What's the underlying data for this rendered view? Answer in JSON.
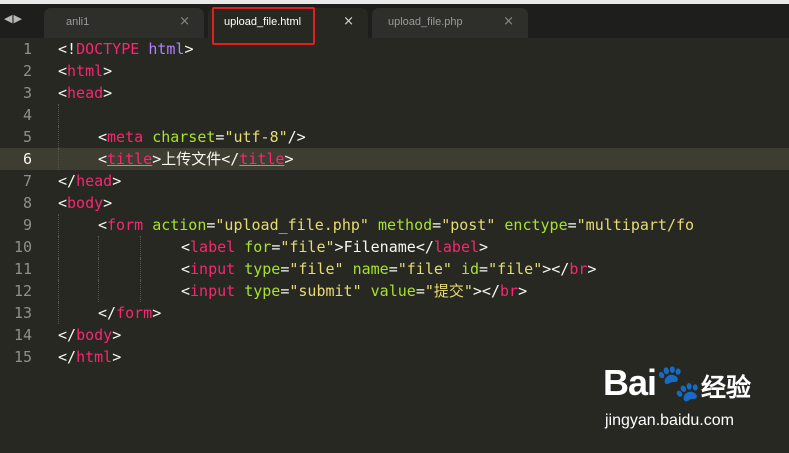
{
  "nav": {
    "arrows": "◀▶"
  },
  "tabs": [
    {
      "label": "anli1",
      "close": "×"
    },
    {
      "label": "upload_file.html",
      "close": "×"
    },
    {
      "label": "upload_file.php",
      "close": "×"
    }
  ],
  "gutter": [
    "1",
    "2",
    "3",
    "4",
    "5",
    "6",
    "7",
    "8",
    "9",
    "10",
    "11",
    "12",
    "13",
    "14",
    "15"
  ],
  "code": {
    "l1": {
      "p1": "<!",
      "tag": "DOCTYPE",
      "sp": " ",
      "name": "html",
      "p2": ">"
    },
    "l2": {
      "p1": "<",
      "tag": "html",
      "p2": ">"
    },
    "l3": {
      "p1": "<",
      "tag": "head",
      "p2": ">"
    },
    "l5": {
      "p1": "<",
      "tag": "meta",
      "sp": " ",
      "a1": "charset",
      "eq": "=",
      "v1": "\"utf-8\"",
      "p2": "/>"
    },
    "l6": {
      "p1": "<",
      "tag": "title",
      "p2": ">",
      "text": "上传文件",
      "p3": "</",
      "ctag": "title",
      "p4": ">"
    },
    "l7": {
      "p1": "</",
      "tag": "head",
      "p2": ">"
    },
    "l8": {
      "p1": "<",
      "tag": "body",
      "p2": ">"
    },
    "l9": {
      "p1": "<",
      "tag": "form",
      "sp1": " ",
      "a1": "action",
      "eq1": "=",
      "v1": "\"upload_file.php\"",
      "sp2": " ",
      "a2": "method",
      "eq2": "=",
      "v2": "\"post\"",
      "sp3": " ",
      "a3": "enctype",
      "eq3": "=",
      "v3": "\"multipart/fo"
    },
    "l10": {
      "p1": "<",
      "tag": "label",
      "sp": " ",
      "a1": "for",
      "eq": "=",
      "v1": "\"file\"",
      "p2": ">",
      "text": "Filename",
      "p3": "</",
      "ctag": "label",
      "p4": ">"
    },
    "l11": {
      "p1": "<",
      "tag": "input",
      "sp1": " ",
      "a1": "type",
      "eq1": "=",
      "v1": "\"file\"",
      "sp2": " ",
      "a2": "name",
      "eq2": "=",
      "v2": "\"file\"",
      "sp3": " ",
      "a3": "id",
      "eq3": "=",
      "v3": "\"file\"",
      "p2": "></",
      "ctag": "br",
      "p3": ">"
    },
    "l12": {
      "p1": "<",
      "tag": "input",
      "sp1": " ",
      "a1": "type",
      "eq1": "=",
      "v1": "\"submit\"",
      "sp2": " ",
      "a2": "value",
      "eq2": "=",
      "v2": "\"提交\"",
      "p2": "></",
      "ctag": "br",
      "p3": ">"
    },
    "l13": {
      "p1": "</",
      "tag": "form",
      "p2": ">"
    },
    "l14": {
      "p1": "</",
      "tag": "body",
      "p2": ">"
    },
    "l15": {
      "p1": "</",
      "tag": "html",
      "p2": ">"
    }
  },
  "watermark": {
    "logo": "Bai🐾",
    "cn": "经验",
    "url": "jingyan.baidu.com"
  },
  "colors": {
    "background": "#272822",
    "tag": "#f92672",
    "attribute": "#a6e22e",
    "string": "#e6db74",
    "doctype": "#ae81ff",
    "highlight": "#e02020"
  }
}
